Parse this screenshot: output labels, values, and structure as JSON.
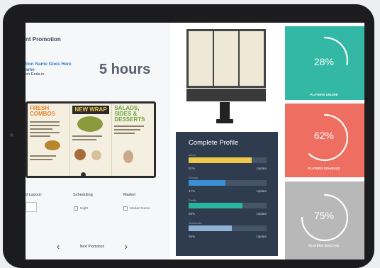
{
  "promo": {
    "title": "nt Promotion",
    "name_line1": "tion Name Goes Here",
    "name_line2": "ame",
    "ends_label": "on Ends in",
    "hours": "5 hours",
    "menu": {
      "col1_head": "FRESH COMBOS",
      "col2_head": "NEW WRAP",
      "col3_head": "SALADS, SIDES & DESSERTS"
    },
    "layout_label": "d Layout:",
    "scheduling_label": "Scheduling",
    "market_label": "Market",
    "scheduling_option": "Night",
    "market_option": "Market Name",
    "next_label": "Next Promotion"
  },
  "profile": {
    "title": "Complete Profile",
    "rows": [
      {
        "label": "Menu",
        "percent": "81%",
        "action": "Update",
        "value": 81,
        "color": "#f0c94c"
      },
      {
        "label": "Groups",
        "percent": "47%",
        "action": "Update",
        "value": 47,
        "color": "#3b8fd4"
      },
      {
        "label": "Profile",
        "percent": "69%",
        "action": "Update",
        "value": 69,
        "color": "#2ab5a2"
      },
      {
        "label": "Schedules",
        "percent": "55%",
        "action": "Update",
        "value": 55,
        "color": "#8fb3d6"
      }
    ]
  },
  "stats": [
    {
      "value": "28%",
      "label": "PLAYERS ONLINE",
      "fraction": 0.28,
      "color": "#32b8a4"
    },
    {
      "value": "62%",
      "label": "PLAYERS DISABLED",
      "fraction": 0.62,
      "color": "#ee6f61"
    },
    {
      "value": "75%",
      "label": "PLAYERS INACTIVE",
      "fraction": 0.75,
      "color": "#b8b8b8"
    }
  ]
}
